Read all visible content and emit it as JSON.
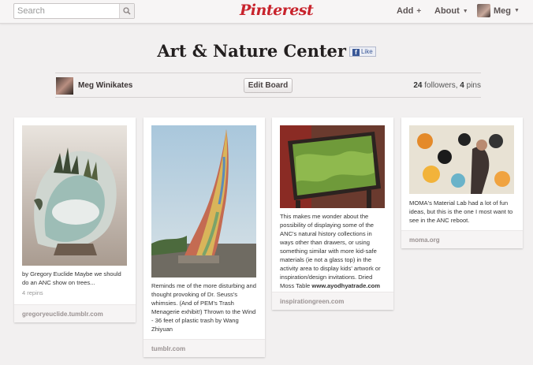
{
  "header": {
    "search_placeholder": "Search",
    "logo": "Pinterest",
    "nav": {
      "add": "Add",
      "about": "About",
      "user": "Meg"
    },
    "add_symbol": "+",
    "caret_symbol": "▼"
  },
  "board": {
    "title": "Art & Nature Center",
    "like_label": "Like",
    "owner": "Meg Winikates",
    "edit_label": "Edit Board",
    "followers_count": "24",
    "followers_label": "followers,",
    "pins_count": "4",
    "pins_label": "pins"
  },
  "pins": [
    {
      "description": "by Gregory Euclide Maybe we should do an ANC show on trees...",
      "repins": "4 repins",
      "source": "gregoryeuclide.tumblr.com"
    },
    {
      "description": "Reminds me of the more disturbing and thought provoking of Dr. Seuss's whimsies. (And of PEM's Trash Menagerie exhibit!) Thrown to the Wind - 36 feet of plastic trash by Wang Zhiyuan",
      "source": "tumblr.com"
    },
    {
      "description": "This makes me wonder about the possibility of displaying some of the ANC's natural history collections in ways other than drawers, or using something similar with more kid-safe materials (ie not a glass top) in the activity area to display kids' artwork or inspiration/design invitations. Dried Moss Table",
      "description_link": "www.ayodhyatrade.com",
      "source": "inspirationgreen.com"
    },
    {
      "description": "MOMA's Material Lab had a lot of fun ideas, but this is the one I most want to see in the ANC reboot.",
      "source": "moma.org"
    }
  ],
  "colors": {
    "brand": "#c8232c",
    "background": "#f2f0f0"
  },
  "icons": {
    "search": "search-icon",
    "facebook": "facebook-icon"
  }
}
